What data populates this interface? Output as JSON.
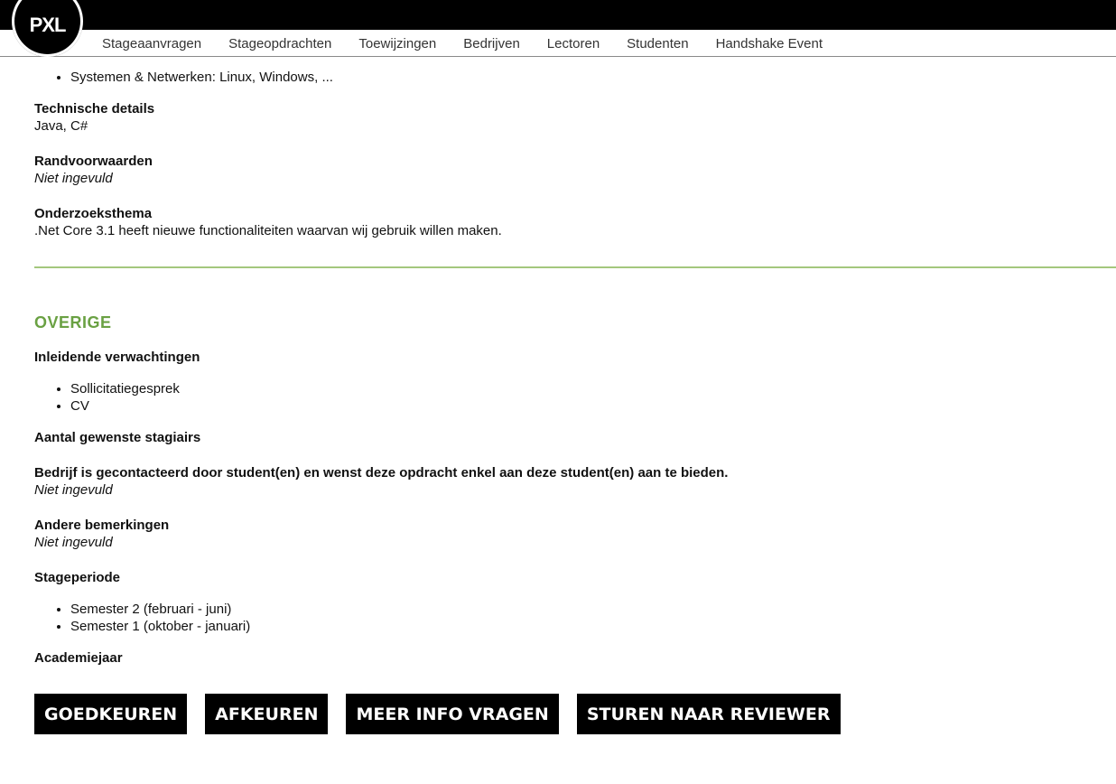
{
  "header": {
    "logo_text": "PXL",
    "nav": [
      "Stageaanvragen",
      "Stageopdrachten",
      "Toewijzingen",
      "Bedrijven",
      "Lectoren",
      "Studenten",
      "Handshake Event"
    ]
  },
  "details": {
    "top_list_item": "Systemen & Netwerken: Linux, Windows, ...",
    "technische_details": {
      "label": "Technische details",
      "value": "Java, C#"
    },
    "randvoorwaarden": {
      "label": "Randvoorwaarden",
      "value": "Niet ingevuld"
    },
    "onderzoeksthema": {
      "label": "Onderzoeksthema",
      "value": ".Net Core 3.1 heeft nieuwe functionaliteiten waarvan wij gebruik willen maken."
    }
  },
  "overige": {
    "title": "OVERIGE",
    "inleidende_verwachtingen": {
      "label": "Inleidende verwachtingen",
      "items": [
        "Sollicitatiegesprek",
        "CV"
      ]
    },
    "aantal_stagiairs": {
      "label": "Aantal gewenste stagiairs"
    },
    "bedrijf_gecontacteerd": {
      "label": "Bedrijf is gecontacteerd door student(en) en wenst deze opdracht enkel aan deze student(en) aan te bieden.",
      "value": "Niet ingevuld"
    },
    "andere_bemerkingen": {
      "label": "Andere bemerkingen",
      "value": "Niet ingevuld"
    },
    "stageperiode": {
      "label": "Stageperiode",
      "items": [
        "Semester 2 (februari - juni)",
        "Semester 1 (oktober - januari)"
      ]
    },
    "academiejaar": {
      "label": "Academiejaar"
    }
  },
  "actions": {
    "approve": "GOEDKEUREN",
    "reject": "AFKEUREN",
    "more_info": "MEER INFO VRAGEN",
    "send_reviewer": "STUREN NAAR REVIEWER"
  },
  "colors": {
    "accent_green": "#6aa143",
    "divider_green": "#a4c77d",
    "topbar": "#000000"
  }
}
